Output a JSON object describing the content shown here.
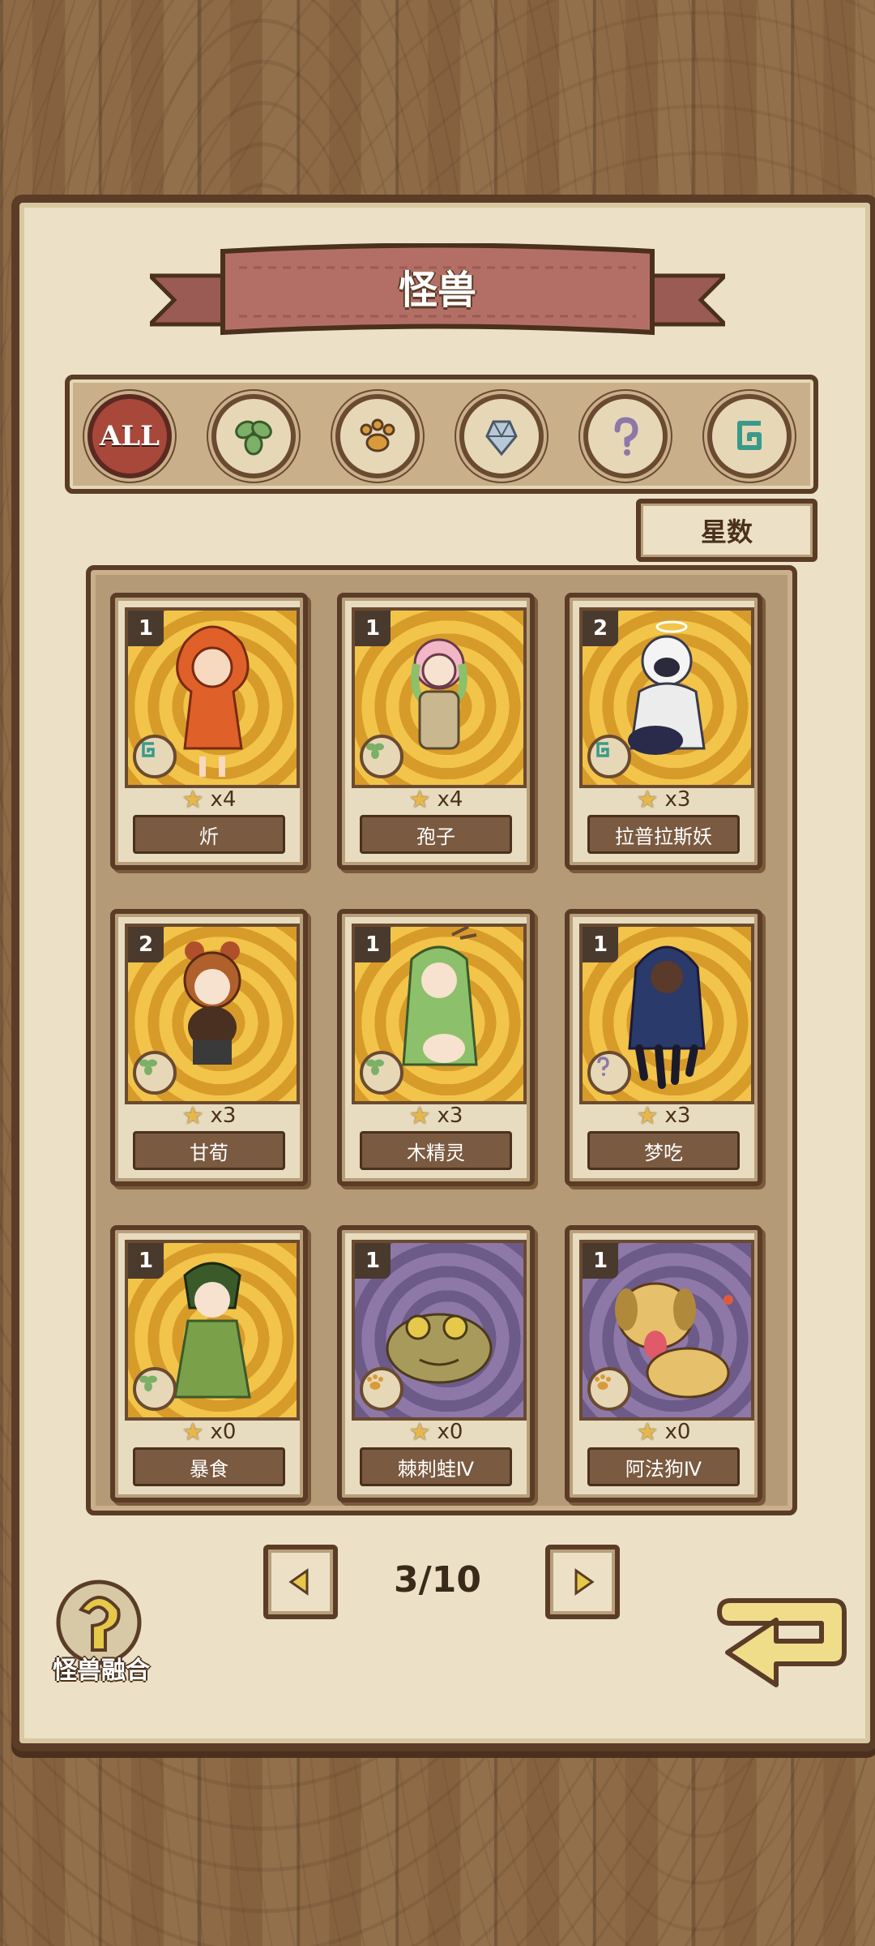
{
  "header": {
    "title": "怪兽"
  },
  "filters": [
    {
      "id": "all",
      "label": "ALL",
      "icon": "all-icon",
      "active": true
    },
    {
      "id": "plant",
      "icon": "leaf-icon",
      "active": false
    },
    {
      "id": "beast",
      "icon": "paw-icon",
      "active": false
    },
    {
      "id": "mineral",
      "icon": "crystal-icon",
      "active": false
    },
    {
      "id": "unknown",
      "icon": "question-icon",
      "active": false
    },
    {
      "id": "spirit",
      "icon": "spiral-icon",
      "active": false
    }
  ],
  "sort": {
    "label": "星数"
  },
  "cards": [
    {
      "level": "1",
      "stars": "x4",
      "name": "炘",
      "type_icon": "spiral-icon",
      "bg": "gold"
    },
    {
      "level": "1",
      "stars": "x4",
      "name": "孢子",
      "type_icon": "leaf-icon",
      "bg": "gold"
    },
    {
      "level": "2",
      "stars": "x3",
      "name": "拉普拉斯妖",
      "type_icon": "spiral-icon",
      "bg": "gold"
    },
    {
      "level": "2",
      "stars": "x3",
      "name": "甘荀",
      "type_icon": "leaf-icon",
      "bg": "gold"
    },
    {
      "level": "1",
      "stars": "x3",
      "name": "木精灵",
      "type_icon": "leaf-icon",
      "bg": "gold"
    },
    {
      "level": "1",
      "stars": "x3",
      "name": "梦吃",
      "type_icon": "question-icon",
      "bg": "gold"
    },
    {
      "level": "1",
      "stars": "x0",
      "name": "暴食",
      "type_icon": "leaf-icon",
      "bg": "gold"
    },
    {
      "level": "1",
      "stars": "x0",
      "name": "棘刺蛙Ⅳ",
      "type_icon": "paw-icon",
      "bg": "purple"
    },
    {
      "level": "1",
      "stars": "x0",
      "name": "阿法狗Ⅳ",
      "type_icon": "paw-icon",
      "bg": "purple"
    }
  ],
  "pager": {
    "current": "3/10"
  },
  "fusion": {
    "label": "怪兽融合"
  },
  "colors": {
    "paper": "#ece1c6",
    "ink": "#5a3c27",
    "banner": "#b36f66",
    "gold": "#f2c44a",
    "purple": "#8d78a8"
  }
}
